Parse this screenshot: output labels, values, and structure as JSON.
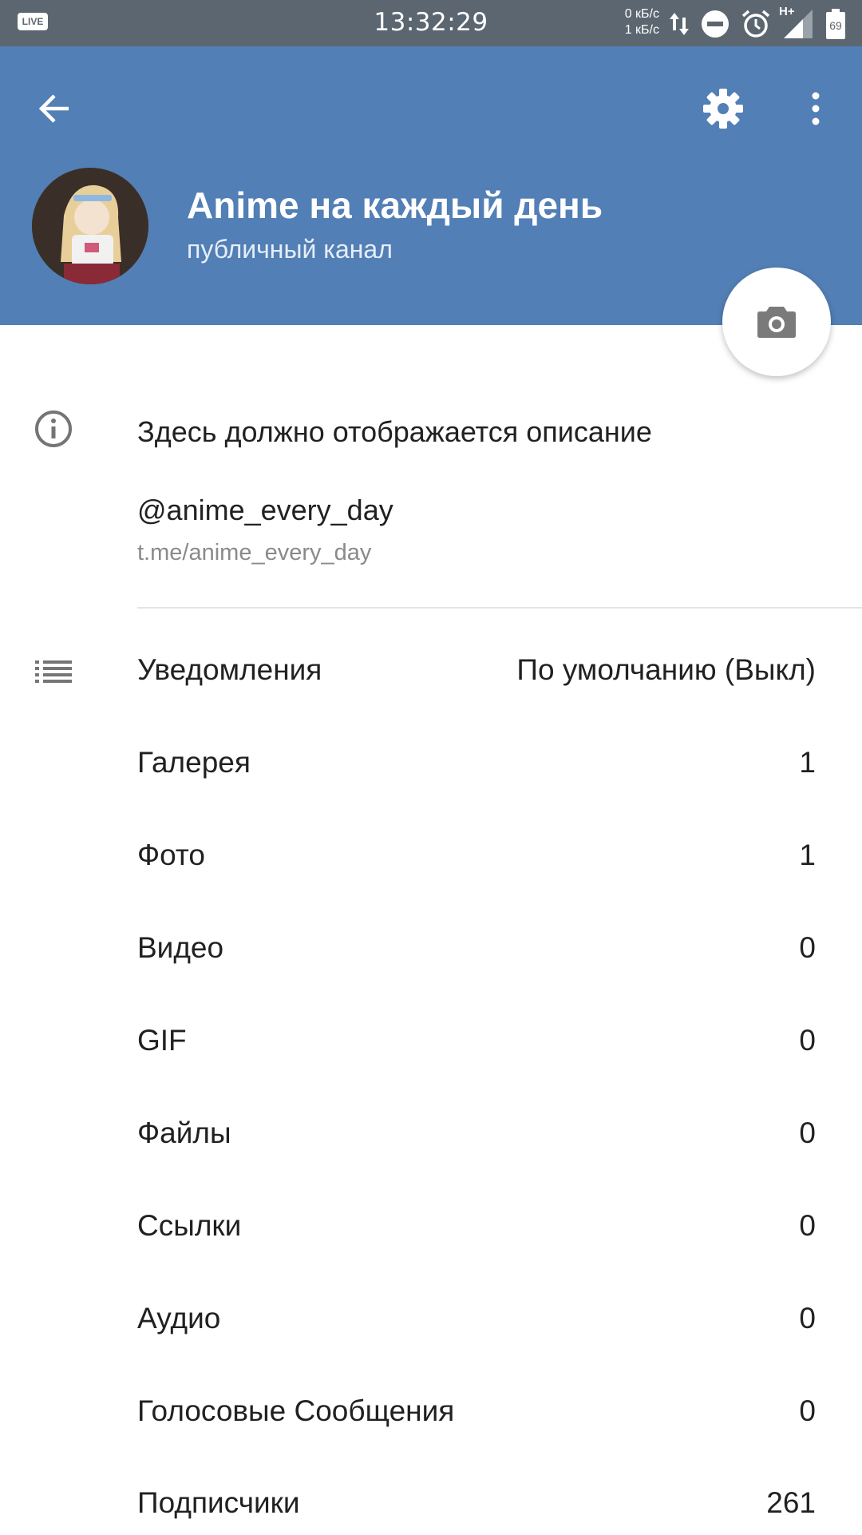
{
  "status_bar": {
    "live_badge": "LIVE",
    "time": "13:32:29",
    "net_down": "0 кБ/с",
    "net_up": "1 кБ/с",
    "network_type": "H+",
    "battery": "69"
  },
  "header": {
    "title": "Anime на каждый день",
    "subtitle": "публичный канал",
    "background_color": "#527fb5"
  },
  "info": {
    "description": "Здесь должно отображается описание",
    "username": "@anime_every_day",
    "link": "t.me/anime_every_day"
  },
  "rows": [
    {
      "label": "Уведомления",
      "value": "По умолчанию (Выкл)"
    },
    {
      "label": "Галерея",
      "value": "1"
    },
    {
      "label": "Фото",
      "value": "1"
    },
    {
      "label": "Видео",
      "value": "0"
    },
    {
      "label": "GIF",
      "value": "0"
    },
    {
      "label": "Файлы",
      "value": "0"
    },
    {
      "label": "Ссылки",
      "value": "0"
    },
    {
      "label": "Аудио",
      "value": "0"
    },
    {
      "label": "Голосовые Сообщения",
      "value": "0"
    },
    {
      "label": "Подписчики",
      "value": "261"
    }
  ]
}
